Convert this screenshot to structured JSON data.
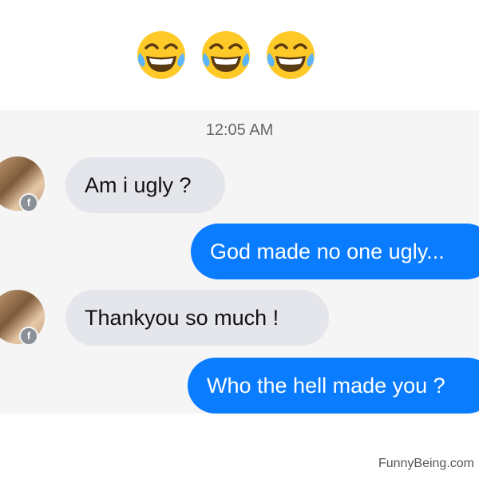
{
  "emojis": [
    {
      "icon": "face-with-tears-of-joy-icon"
    },
    {
      "icon": "face-with-tears-of-joy-icon"
    },
    {
      "icon": "face-with-tears-of-joy-icon"
    }
  ],
  "chat": {
    "timestamp": "12:05 AM",
    "messages": [
      {
        "direction": "incoming",
        "text": "Am i ugly ?"
      },
      {
        "direction": "outgoing",
        "text": "God made no one ugly..."
      },
      {
        "direction": "incoming",
        "text": "Thankyou so much !"
      },
      {
        "direction": "outgoing",
        "text": "Who the hell made you ?"
      }
    ],
    "avatar_badge": "f"
  },
  "colors": {
    "outgoing_bubble": "#0a7cff",
    "incoming_bubble": "#e4e6eb",
    "chat_background": "#f5f5f5"
  },
  "watermark": "FunnyBeing.com"
}
